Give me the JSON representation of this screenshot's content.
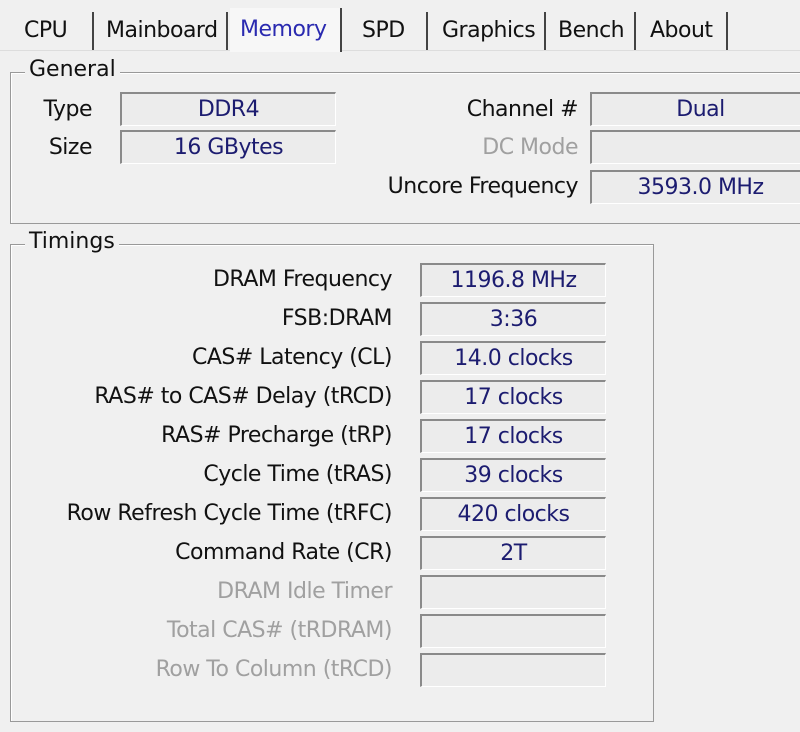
{
  "tabs": [
    {
      "label": "CPU"
    },
    {
      "label": "Mainboard"
    },
    {
      "label": "Memory",
      "active": true
    },
    {
      "label": "SPD"
    },
    {
      "label": "Graphics"
    },
    {
      "label": "Bench"
    },
    {
      "label": "About"
    }
  ],
  "general": {
    "title": "General",
    "type": {
      "label": "Type",
      "value": "DDR4"
    },
    "size": {
      "label": "Size",
      "value": "16 GBytes"
    },
    "channel": {
      "label": "Channel #",
      "value": "Dual"
    },
    "dc_mode": {
      "label": "DC Mode",
      "value": ""
    },
    "uncore": {
      "label": "Uncore Frequency",
      "value": "3593.0 MHz"
    }
  },
  "timings": {
    "title": "Timings",
    "rows": [
      {
        "label": "DRAM Frequency",
        "value": "1196.8 MHz"
      },
      {
        "label": "FSB:DRAM",
        "value": "3:36"
      },
      {
        "label": "CAS# Latency (CL)",
        "value": "14.0 clocks"
      },
      {
        "label": "RAS# to CAS# Delay (tRCD)",
        "value": "17 clocks"
      },
      {
        "label": "RAS# Precharge (tRP)",
        "value": "17 clocks"
      },
      {
        "label": "Cycle Time (tRAS)",
        "value": "39 clocks"
      },
      {
        "label": "Row Refresh Cycle Time (tRFC)",
        "value": "420 clocks"
      },
      {
        "label": "Command Rate (CR)",
        "value": "2T"
      },
      {
        "label": "DRAM Idle Timer",
        "value": "",
        "disabled": true
      },
      {
        "label": "Total CAS# (tRDRAM)",
        "value": "",
        "disabled": true
      },
      {
        "label": "Row To Column (tRCD)",
        "value": "",
        "disabled": true
      }
    ]
  },
  "colors": {
    "value_text": "#1c1c70",
    "active_tab": "#2a2ab0",
    "disabled": "#a0a0a0"
  }
}
